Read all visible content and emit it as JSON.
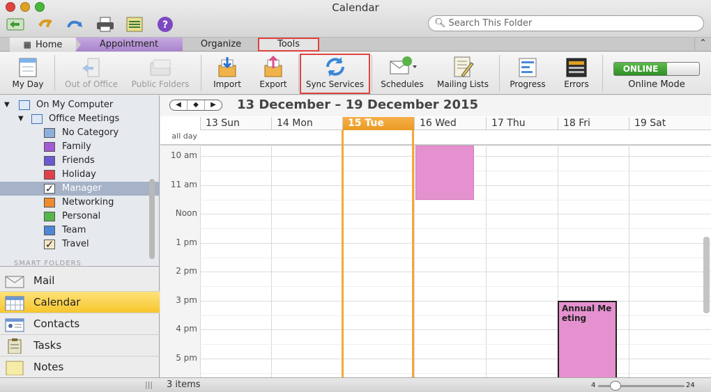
{
  "window": {
    "title": "Calendar"
  },
  "search": {
    "placeholder": "Search This Folder"
  },
  "tabs": {
    "home": "Home",
    "appointment": "Appointment",
    "organize": "Organize",
    "tools": "Tools"
  },
  "toolbar": {
    "my_day": "My Day",
    "out_of_office": "Out of Office",
    "public_folders": "Public Folders",
    "import": "Import",
    "export": "Export",
    "sync_services": "Sync Services",
    "schedules": "Schedules",
    "mailing_lists": "Mailing Lists",
    "progress": "Progress",
    "errors": "Errors",
    "online_mode": "Online Mode",
    "online_state": "ONLINE"
  },
  "sidebar": {
    "root": "On My Computer",
    "group": "Office Meetings",
    "categories": [
      {
        "label": "No Category",
        "color": "#8fb0dd",
        "checked": false
      },
      {
        "label": "Family",
        "color": "#a35ad6",
        "checked": false
      },
      {
        "label": "Friends",
        "color": "#6a5ad0",
        "checked": false
      },
      {
        "label": "Holiday",
        "color": "#e0404a",
        "checked": false
      },
      {
        "label": "Manager",
        "color": "#ffffff",
        "checked": true
      },
      {
        "label": "Networking",
        "color": "#ef8a2e",
        "checked": false
      },
      {
        "label": "Personal",
        "color": "#58b54a",
        "checked": false
      },
      {
        "label": "Team",
        "color": "#4d86d6",
        "checked": false
      },
      {
        "label": "Travel",
        "color": "#f4e6c6",
        "checked": true
      }
    ],
    "smart_folders": "SMART FOLDERS"
  },
  "nav": {
    "mail": "Mail",
    "calendar": "Calendar",
    "contacts": "Contacts",
    "tasks": "Tasks",
    "notes": "Notes"
  },
  "calendar": {
    "range": "13 December – 19 December 2015",
    "days": [
      "13 Sun",
      "14 Mon",
      "15 Tue",
      "16 Wed",
      "17 Thu",
      "18  Fri",
      "19  Sat"
    ],
    "today_index": 2,
    "allday_label": "all day",
    "time_labels": [
      "10 am",
      "11 am",
      "Noon",
      "1 pm",
      "2 pm",
      "3 pm",
      "4 pm",
      "5 pm"
    ],
    "events": [
      {
        "day": 3,
        "title": ""
      },
      {
        "day": 5,
        "title": "Annual Meeting"
      }
    ]
  },
  "status": {
    "items": "3 items",
    "zoom_min": "4",
    "zoom_max": "24",
    "zoom_value": 0.2
  },
  "colors": {
    "accent_today": "#f1a93a",
    "event": "#e591cf",
    "highlight": "#e0433e"
  }
}
